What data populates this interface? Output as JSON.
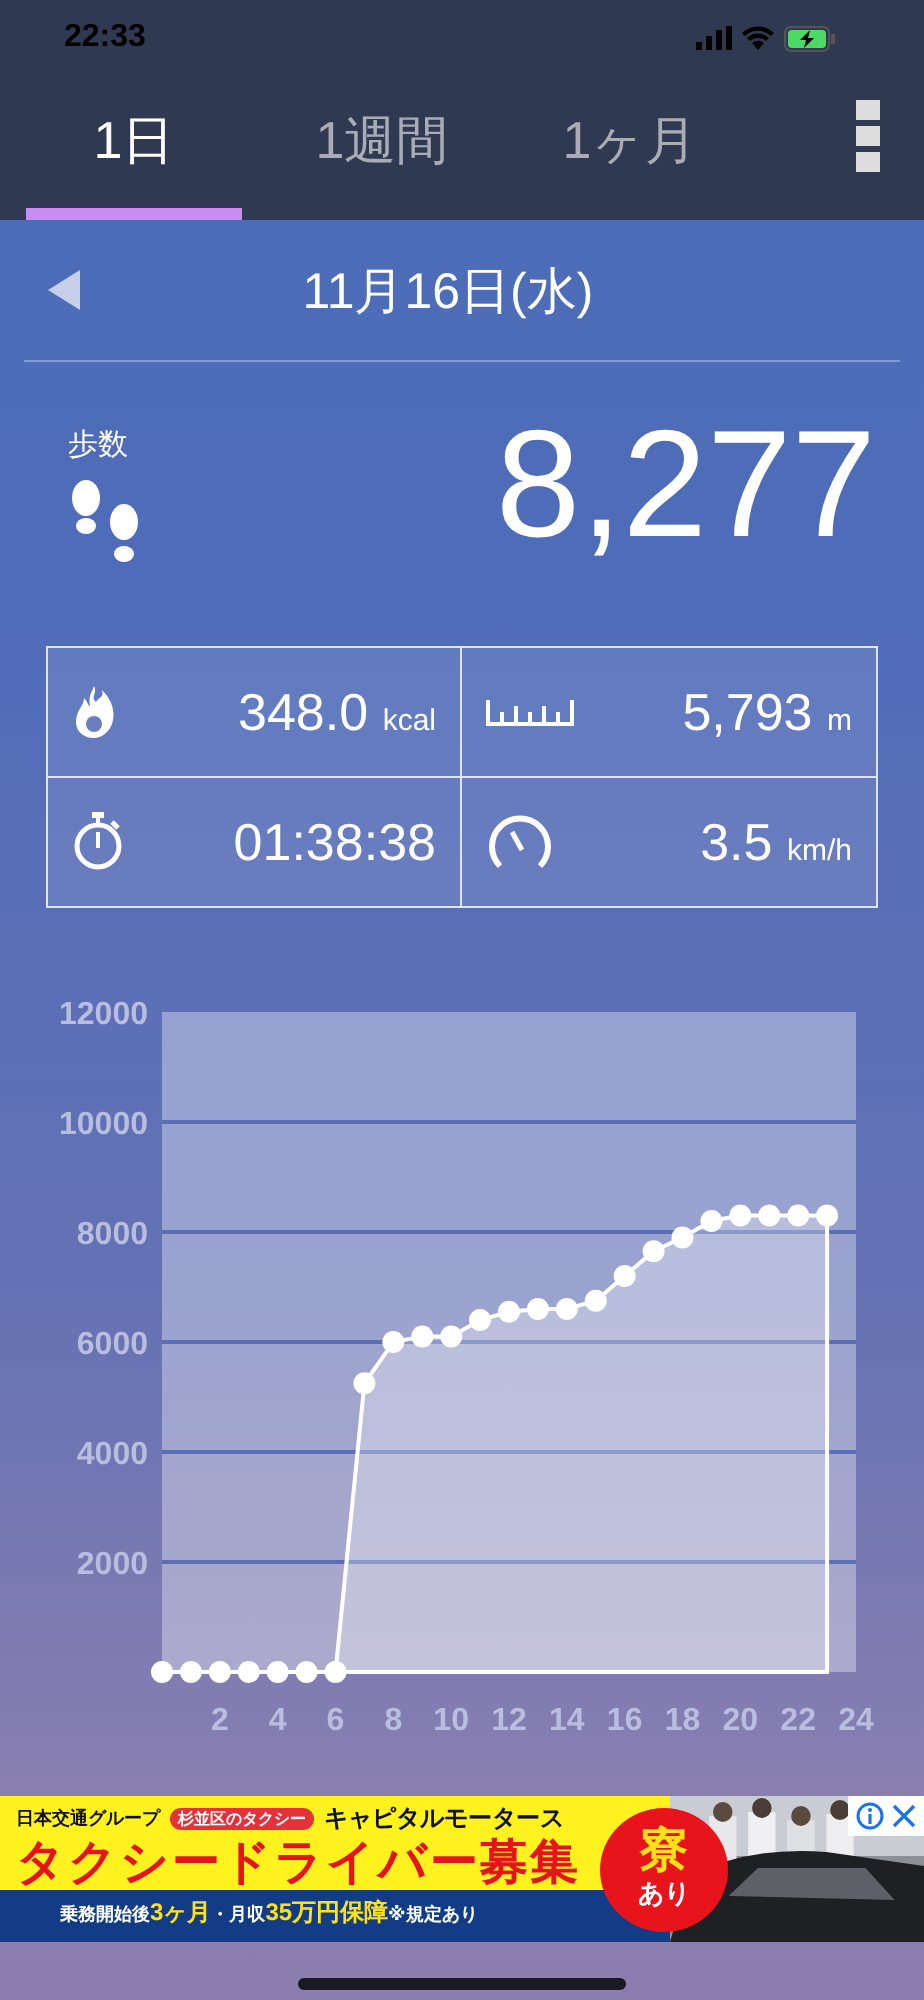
{
  "status_bar": {
    "time": "22:33"
  },
  "tabs": [
    {
      "label": "1日",
      "selected": true
    },
    {
      "label": "1週間",
      "selected": false
    },
    {
      "label": "1ヶ月",
      "selected": false
    }
  ],
  "date": "11月16日(水)",
  "steps": {
    "label": "歩数",
    "value": "8,277"
  },
  "stats": [
    {
      "kind": "calories",
      "value": "348.0",
      "unit": "kcal"
    },
    {
      "kind": "distance",
      "value": "5,793",
      "unit": "m"
    },
    {
      "kind": "time",
      "value": "01:38:38"
    },
    {
      "kind": "speed",
      "value": "3.5",
      "unit": "km/h"
    }
  ],
  "chart": {
    "chart_data": {
      "type": "area",
      "x": [
        0,
        1,
        2,
        3,
        4,
        5,
        6,
        7,
        8,
        9,
        10,
        11,
        12,
        13,
        14,
        15,
        16,
        17,
        18,
        19,
        20,
        21,
        22,
        23
      ],
      "series": [
        {
          "color": "#ffffff",
          "values": [
            0,
            0,
            0,
            0,
            0,
            0,
            0,
            5250,
            6000,
            6100,
            6100,
            6400,
            6550,
            6600,
            6600,
            6750,
            7200,
            7650,
            7900,
            8200,
            8300,
            8300,
            8300,
            8300
          ]
        }
      ],
      "grid": true,
      "xlim": [
        0,
        24
      ],
      "ylim": [
        0,
        12000
      ],
      "xticks": [
        2,
        4,
        6,
        8,
        10,
        12,
        14,
        16,
        18,
        20,
        22,
        24
      ],
      "yticks": [
        2000,
        4000,
        6000,
        8000,
        10000,
        12000
      ]
    }
  },
  "ad": {
    "group": "日本交通グループ",
    "tag": "杉並区のタクシー",
    "company": "キャピタルモータース",
    "headline": "タクシードライバー募集",
    "badge_top": "寮",
    "badge_bottom": "あり",
    "footer": "乗務開始後**3ヶ月**・月収**35万円保障**※規定あり"
  }
}
